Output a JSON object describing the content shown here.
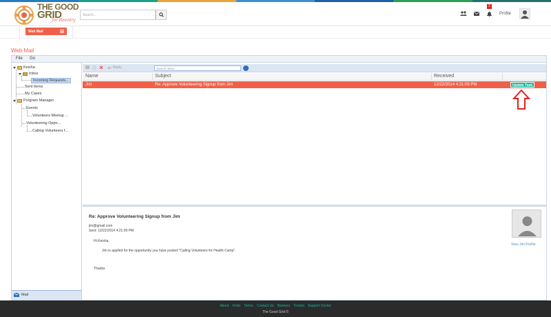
{
  "colorbar": [
    "#2a7bbf",
    "#1f9f8a",
    "#e9a53b",
    "#3f8fd0",
    "#1c5fa6",
    "#2a9e55",
    "#24706b"
  ],
  "header": {
    "logo_line1": "THE GOOD",
    "logo_line2": "GRID",
    "logo_sub": "for Reentry",
    "search_placeholder": "Search...",
    "notification_count": "2",
    "profile_label": "Profile"
  },
  "subnav": {
    "webmail_label": "Web Mail"
  },
  "page_title": "Web Mail",
  "menubar": {
    "file": "File",
    "go": "Go"
  },
  "tree": {
    "root": "Keisha",
    "inbox": "Inbox",
    "incoming": "Incoming Requests...",
    "sent": "Sent Items",
    "cases": "My Cases",
    "program_manager": "Program Manager",
    "events": "Events",
    "volunteers_meetup": "Volunteers Meetup ...",
    "volunteering_oppo": "Volunteering Oppo...",
    "calling_volunteers": "Calling Volunteers f..."
  },
  "left_bottom": {
    "mail_label": "Mail"
  },
  "toolbar": {
    "reply_label": "Reply",
    "search_placeholder": "Search Inbox"
  },
  "grid": {
    "columns": [
      "Name",
      "Subject",
      "Received"
    ],
    "row": {
      "name": "Jim",
      "subject": "Re: Approve Volunteering Signup from Jim",
      "received": "12/22/2014 4:21:09 PM",
      "action": "Update Task"
    }
  },
  "preview": {
    "subject": "Re: Approve Volunteering Signup from Jim",
    "from": "jim@gmail.com",
    "sent": "Sent: 12/22/2014 4:21:09 PM",
    "greeting": "Hi Keisha,",
    "body": "Jim is applied for the opportunity you have posted \"Calling Volunteers for Health Camp\".",
    "thanks": "Thanks",
    "profile_link": "View Jim Profile"
  },
  "footer": {
    "links": [
      "About",
      "Invite",
      "Terms",
      "Contact Us",
      "Banners",
      "Tickets",
      "Support Center"
    ],
    "copyright": "The Good Grid ©"
  }
}
